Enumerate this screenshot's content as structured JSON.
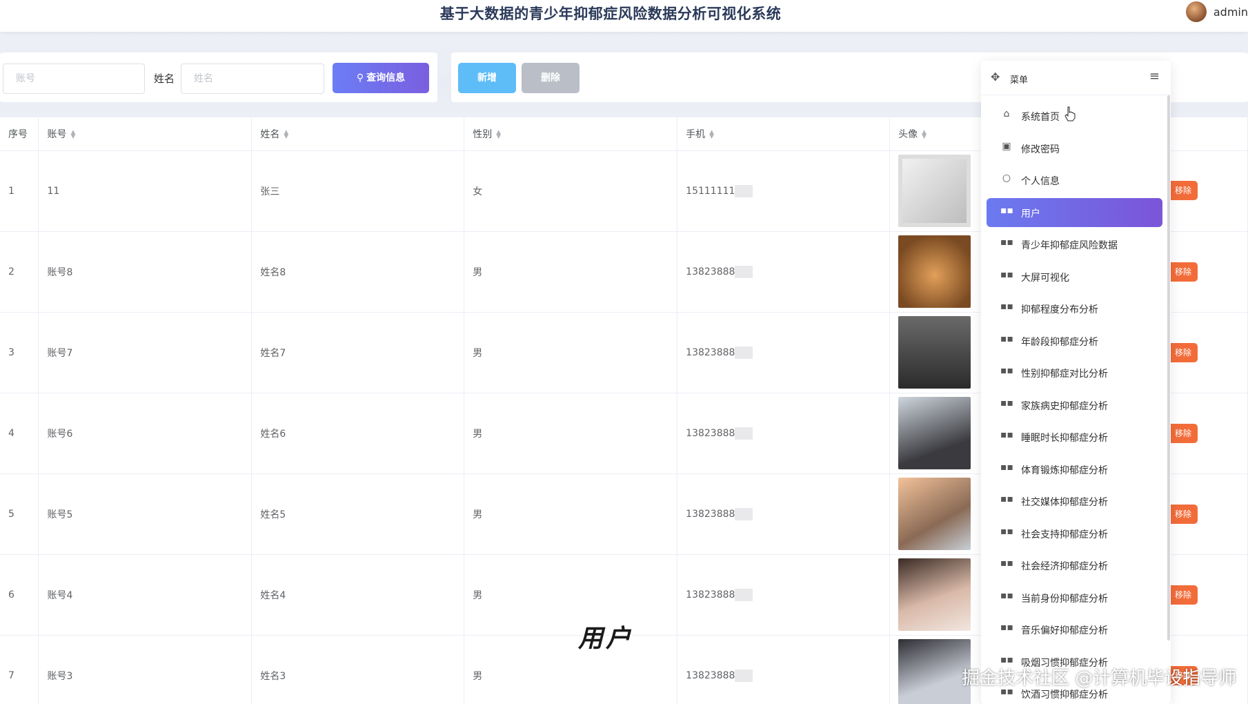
{
  "header": {
    "title": "基于大数据的青少年抑郁症风险数据分析可视化系统",
    "user_name": "admin"
  },
  "search": {
    "account_placeholder": "账号",
    "name_label": "姓名",
    "name_placeholder": "姓名",
    "query_label": "查询信息"
  },
  "actions": {
    "add_label": "新增",
    "delete_label": "删除"
  },
  "table": {
    "columns": [
      "序号",
      "账号",
      "姓名",
      "性别",
      "手机",
      "头像"
    ],
    "rows": [
      {
        "index": "1",
        "account": "11",
        "name": "张三",
        "gender": "女",
        "phone": "15111111",
        "delete_label": "移除"
      },
      {
        "index": "2",
        "account": "账号8",
        "name": "姓名8",
        "gender": "男",
        "phone": "13823888",
        "delete_label": "移除"
      },
      {
        "index": "3",
        "account": "账号7",
        "name": "姓名7",
        "gender": "男",
        "phone": "13823888",
        "delete_label": "移除"
      },
      {
        "index": "4",
        "account": "账号6",
        "name": "姓名6",
        "gender": "男",
        "phone": "13823888",
        "delete_label": "移除"
      },
      {
        "index": "5",
        "account": "账号5",
        "name": "姓名5",
        "gender": "男",
        "phone": "13823888",
        "delete_label": "移除"
      },
      {
        "index": "6",
        "account": "账号4",
        "name": "姓名4",
        "gender": "男",
        "phone": "13823888",
        "delete_label": "移除"
      },
      {
        "index": "7",
        "account": "账号3",
        "name": "姓名3",
        "gender": "男",
        "phone": "13823888",
        "delete_label": "移除"
      }
    ]
  },
  "menu": {
    "title": "菜单",
    "items": [
      {
        "label": "系统首页",
        "icon": "home-icon"
      },
      {
        "label": "修改密码",
        "icon": "lock-icon"
      },
      {
        "label": "个人信息",
        "icon": "user-icon"
      },
      {
        "label": "用户",
        "icon": "grid-icon",
        "active": true
      },
      {
        "label": "青少年抑郁症风险数据",
        "icon": "grid-icon"
      },
      {
        "label": "大屏可视化",
        "icon": "grid-icon"
      },
      {
        "label": "抑郁程度分布分析",
        "icon": "grid-icon"
      },
      {
        "label": "年龄段抑郁症分析",
        "icon": "grid-icon"
      },
      {
        "label": "性别抑郁症对比分析",
        "icon": "grid-icon"
      },
      {
        "label": "家族病史抑郁症分析",
        "icon": "grid-icon"
      },
      {
        "label": "睡眠时长抑郁症分析",
        "icon": "grid-icon"
      },
      {
        "label": "体育锻炼抑郁症分析",
        "icon": "grid-icon"
      },
      {
        "label": "社交媒体抑郁症分析",
        "icon": "grid-icon"
      },
      {
        "label": "社会支持抑郁症分析",
        "icon": "grid-icon"
      },
      {
        "label": "社会经济抑郁症分析",
        "icon": "grid-icon"
      },
      {
        "label": "当前身份抑郁症分析",
        "icon": "grid-icon"
      },
      {
        "label": "音乐偏好抑郁症分析",
        "icon": "grid-icon"
      },
      {
        "label": "吸烟习惯抑郁症分析",
        "icon": "grid-icon"
      },
      {
        "label": "饮酒习惯抑郁症分析",
        "icon": "grid-icon"
      }
    ]
  },
  "overlay": {
    "caption": "用户",
    "watermark": "掘金技术社区 @计算机毕设指导师"
  },
  "colors": {
    "accent": "#6b7af0",
    "add_button": "#5ebcf7",
    "delete_button": "#b9bec7",
    "row_delete": "#f26c3a"
  }
}
